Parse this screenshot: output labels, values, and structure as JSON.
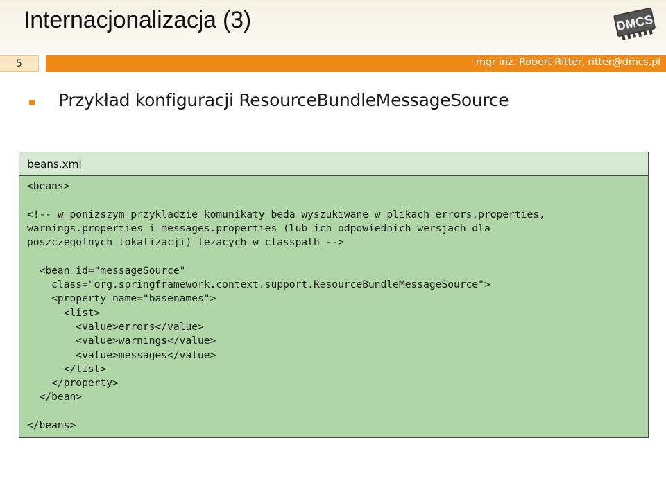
{
  "slide": {
    "title": "Internacjonalizacja (3)",
    "number": "5",
    "author": "mgr inż. Robert Ritter, ritter@dmcs.pl",
    "logo_text": "DMCS",
    "logo_icon": "dmcs-chip-logo"
  },
  "content": {
    "bullet": "Przykład konfiguracji ResourceBundleMessageSource",
    "bullet_icon": "square-bullet"
  },
  "code_box": {
    "filename": "beans.xml",
    "lines": [
      "<beans>",
      "",
      "<!-- w ponizszym przykladzie komunikaty beda wyszukiwane w plikach errors.properties,",
      "warnings.properties i messages.properties (lub ich odpowiednich wersjach dla",
      "poszczegolnych lokalizacji) lezacych w classpath -->",
      "",
      "  <bean id=\"messageSource\"",
      "    class=\"org.springframework.context.support.ResourceBundleMessageSource\">",
      "    <property name=\"basenames\">",
      "      <list>",
      "        <value>errors</value>",
      "        <value>warnings</value>",
      "        <value>messages</value>",
      "      </list>",
      "    </property>",
      "  </bean>",
      "",
      "</beans>"
    ]
  },
  "colors": {
    "accent": "#ef8a17",
    "code_bg": "#b0d6a7",
    "code_header_bg": "#d6e9d2"
  }
}
